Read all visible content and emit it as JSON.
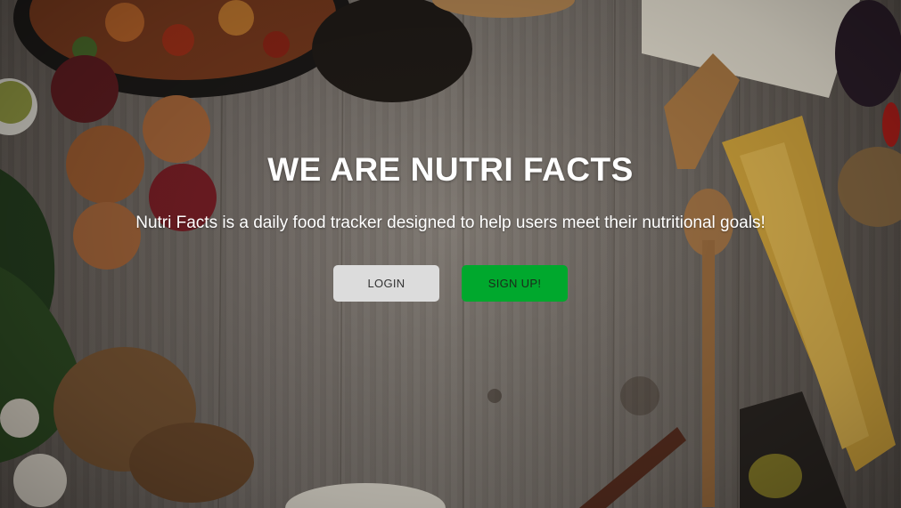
{
  "hero": {
    "title": "WE ARE NUTRI FACTS",
    "subtitle": "Nutri Facts is a daily food tracker designed to help users meet their nutritional goals!"
  },
  "actions": {
    "login_label": "LOGIN",
    "signup_label": "SIGN UP!"
  },
  "colors": {
    "login_bg": "#dcdcdc",
    "signup_bg": "#00a82d",
    "text": "#ffffff"
  }
}
